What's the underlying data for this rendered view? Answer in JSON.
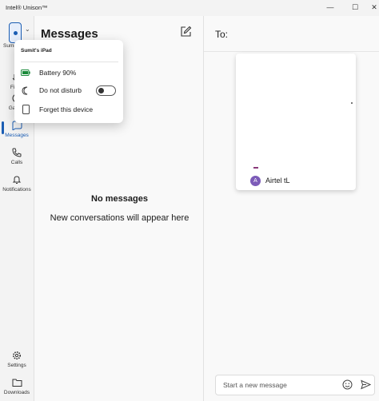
{
  "window": {
    "title": "Intel® Unison™",
    "controls": {
      "minimize": "—",
      "maximize": "☐",
      "close": "✕"
    }
  },
  "rail": {
    "device_label": "Sumit's",
    "items": [
      {
        "label": "File tr",
        "icon": "file-transfer-icon"
      },
      {
        "label": "Gallery",
        "icon": "gallery-icon"
      },
      {
        "label": "Messages",
        "icon": "messages-icon",
        "active": true
      },
      {
        "label": "Calls",
        "icon": "phone-icon"
      },
      {
        "label": "Notifications",
        "icon": "bell-icon"
      }
    ],
    "bottom_items": [
      {
        "label": "Settings",
        "icon": "gear-icon"
      },
      {
        "label": "Downloads",
        "icon": "folder-icon"
      }
    ],
    "accent_color": "#1b5db3"
  },
  "messages": {
    "title": "Messages",
    "empty_title": "No messages",
    "empty_subtitle": "New conversations will appear here"
  },
  "chat": {
    "to_label": "To:",
    "contact_initial": "A",
    "contact_name": "Airtel tL",
    "composer_placeholder": "Start a new message"
  },
  "device_flyout": {
    "device_name": "Sumit's iPad",
    "battery": "Battery 90%",
    "do_not_disturb": "Do not disturb",
    "do_not_disturb_on": false,
    "forget": "Forget this device"
  }
}
